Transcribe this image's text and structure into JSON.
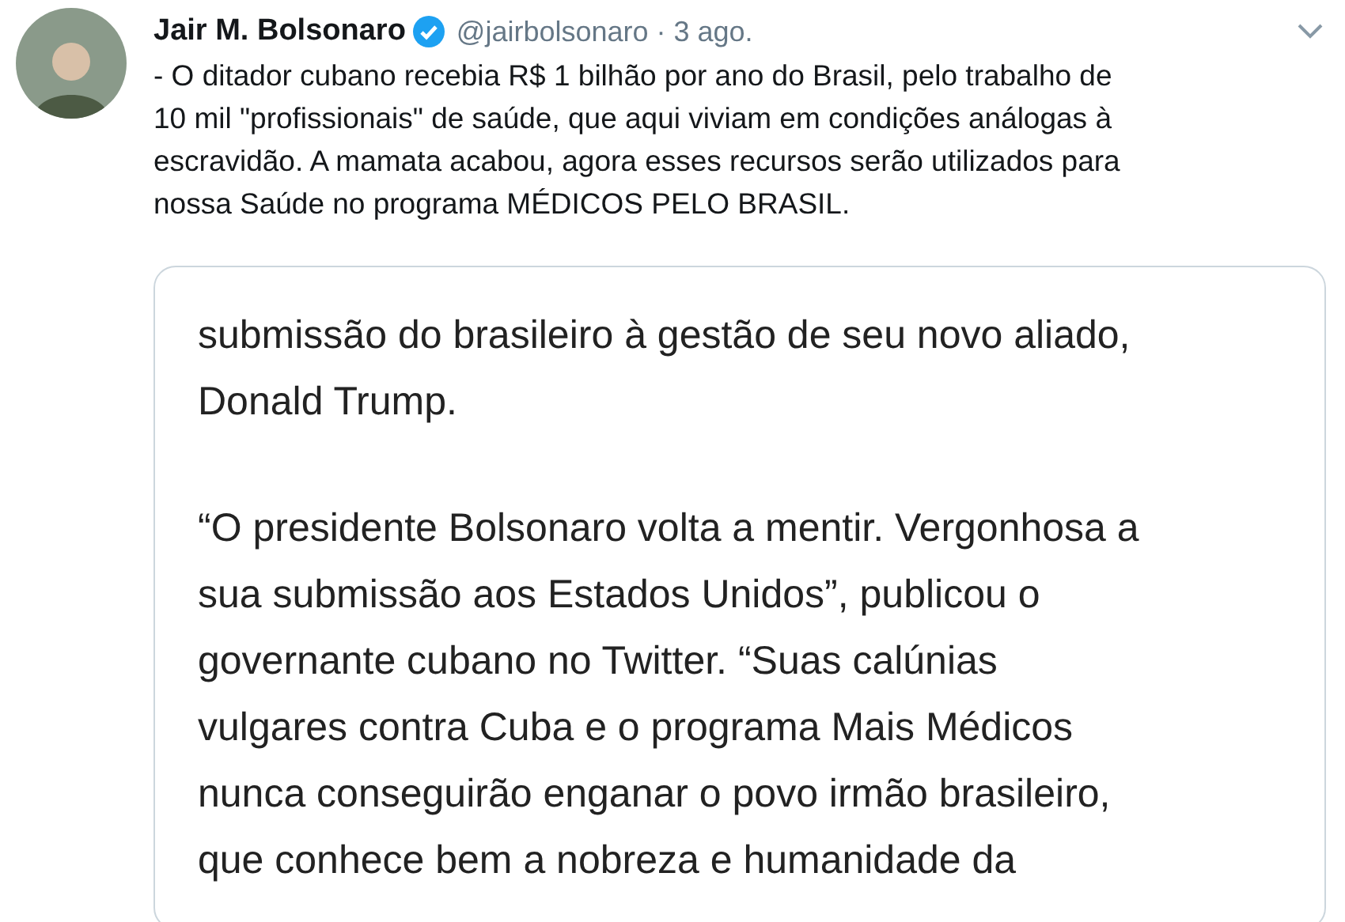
{
  "tweet": {
    "author": {
      "name": "Jair M. Bolsonaro",
      "verified": true,
      "handle": "@jairbolsonaro",
      "time": "· 3 ago."
    },
    "text_lines": [
      "- O ditador cubano recebia R$ 1 bilhão por ano do Brasil, pelo trabalho de",
      "10 mil \"profissionais\" de saúde, que aqui viviam em condições análogas à",
      "escravidão. A mamata acabou, agora esses recursos serão utilizados para",
      "nossa Saúde no programa MÉDICOS PELO BRASIL."
    ],
    "attached_image": {
      "paragraphs": [
        [
          "submissão do brasileiro à gestão de seu novo aliado,",
          "Donald Trump."
        ],
        [
          "“O presidente Bolsonaro volta a mentir. Vergonhosa a",
          "sua submissão aos Estados Unidos”, publicou o",
          "governante cubano no Twitter. “Suas calúnias",
          "vulgares contra Cuba e o programa Mais Médicos",
          "nunca conseguirão enganar o povo irmão brasileiro,",
          "que conhece bem a nobreza e humanidade da"
        ]
      ]
    }
  }
}
